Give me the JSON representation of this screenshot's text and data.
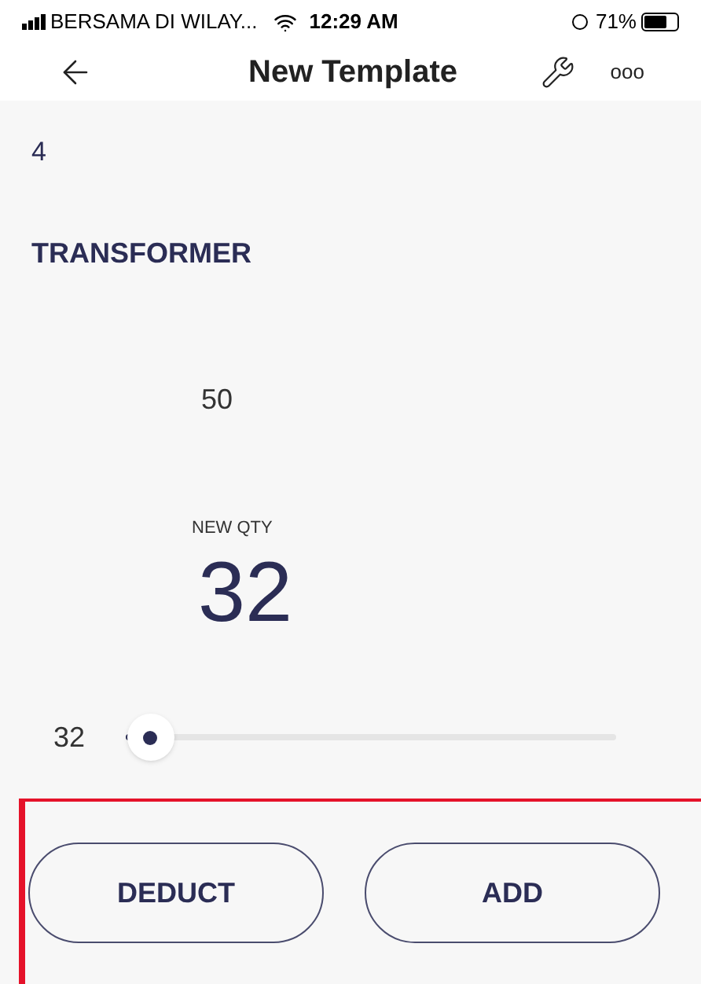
{
  "status_bar": {
    "carrier": "BERSAMA DI WILAY...",
    "time": "12:29 AM",
    "battery": "71%"
  },
  "nav": {
    "title": "New Template",
    "more": "ooo"
  },
  "item": {
    "number": "4",
    "name": "TRANSFORMER",
    "current": "50",
    "new_qty_label": "NEW QTY",
    "new_qty": "32"
  },
  "slider": {
    "reading": "32",
    "level": 0.05
  },
  "actions": {
    "highlighted": true,
    "buttons": [
      "DEDUCT",
      "ADD"
    ]
  }
}
